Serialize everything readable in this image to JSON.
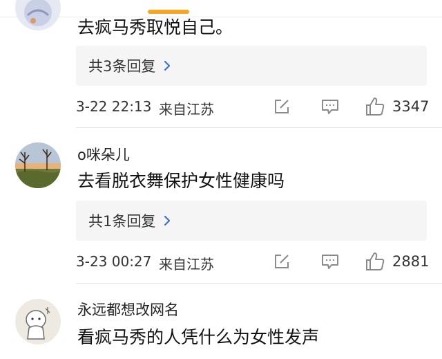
{
  "comments": [
    {
      "text": "去疯马秀取悦自己。",
      "replies_label": "共3条回复",
      "time": "3-22 22:13",
      "location": "来自江苏",
      "likes": "3347"
    },
    {
      "name": "o咪朵儿",
      "text": "去看脱衣舞保护女性健康吗",
      "replies_label": "共1条回复",
      "time": "3-23 00:27",
      "location": "来自江苏",
      "likes": "2881"
    },
    {
      "name": "永远都想改网名",
      "text": "看疯马秀的人凭什么为女性发声"
    }
  ],
  "icons": {
    "share": "edit-share-icon",
    "comment": "comment-bubble-icon",
    "like": "thumbs-up-icon",
    "chevron": "chevron-right-icon"
  },
  "colors": {
    "indicator": "#f5a623",
    "link": "#3b6fd1",
    "icon": "#8a8a8a"
  }
}
